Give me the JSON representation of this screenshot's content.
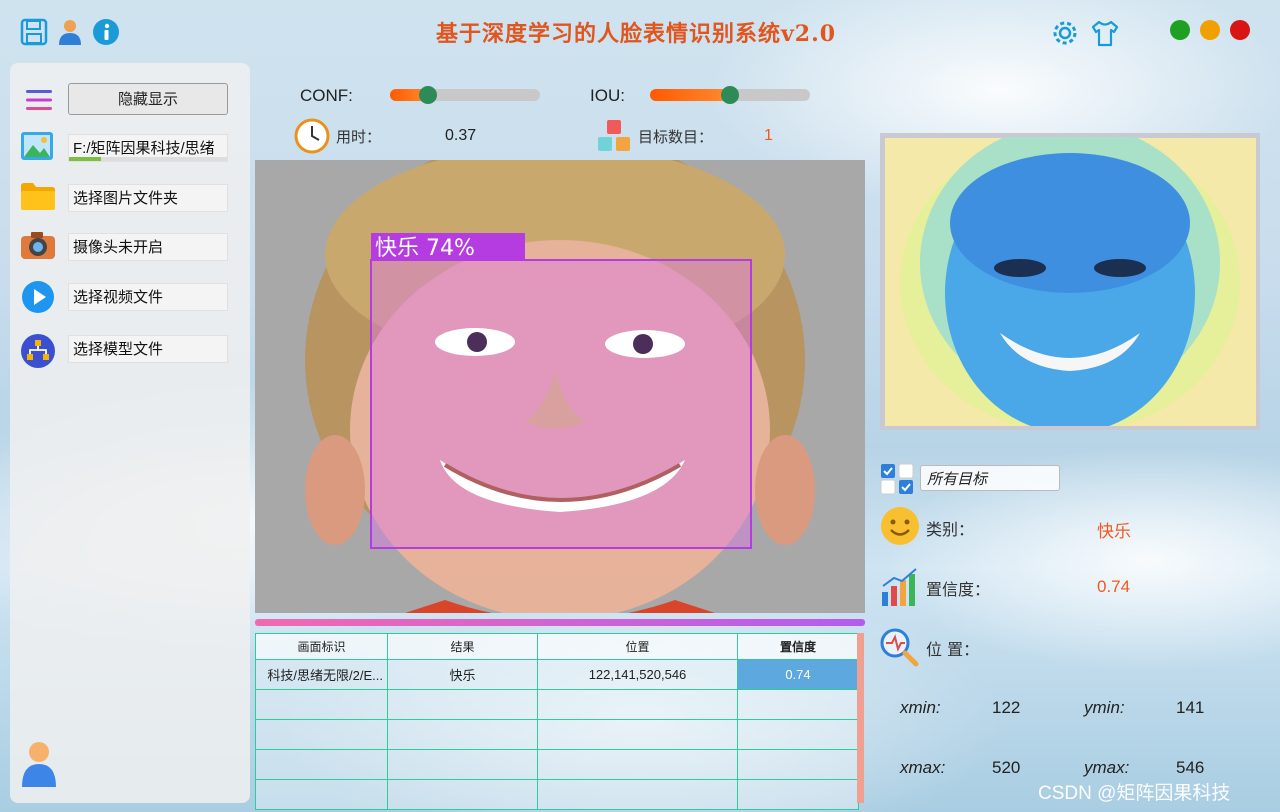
{
  "window": {
    "title": "基于深度学习的人脸表情识别系统v2.0",
    "controls": [
      "close",
      "minimize",
      "maximize"
    ]
  },
  "toolbar": {
    "left_icons": [
      "save-icon",
      "user-icon",
      "info-icon"
    ],
    "right_icons": [
      "gear-icon",
      "shirt-icon"
    ]
  },
  "sidebar": {
    "toggle_label": "隐藏显示",
    "items": [
      {
        "icon": "image-icon",
        "label": "F:/矩阵因果科技/思绪"
      },
      {
        "icon": "folder-icon",
        "label": "选择图片文件夹"
      },
      {
        "icon": "camera-icon",
        "label": "摄像头未开启"
      },
      {
        "icon": "play-icon",
        "label": "选择视频文件"
      },
      {
        "icon": "model-icon",
        "label": "选择模型文件"
      }
    ],
    "progress": 0.2
  },
  "params": {
    "conf_label": "CONF:",
    "conf_value": 0.25,
    "iou_label": "IOU:",
    "iou_value": 0.5
  },
  "stats": {
    "time_label": "用时：",
    "time_value": "0.37",
    "count_label": "目标数目：",
    "count_value": "1"
  },
  "detection": {
    "box_label": "快乐  74%",
    "color": "#b53ce0"
  },
  "table": {
    "headers": [
      "画面标识",
      "结果",
      "位置",
      "置信度"
    ],
    "rows": [
      [
        "科技/思绪无限/2/E...",
        "快乐",
        "122,141,520,546",
        "0.74"
      ],
      [
        "",
        "",
        "",
        ""
      ],
      [
        "",
        "",
        "",
        ""
      ],
      [
        "",
        "",
        "",
        ""
      ],
      [
        "",
        "",
        "",
        ""
      ]
    ]
  },
  "right_panel": {
    "target_select": "所有目标",
    "class_label": "类别：",
    "class_value": "快乐",
    "conf_label": "置信度：",
    "conf_value": "0.74",
    "pos_label": "位  置：",
    "xmin_label": "xmin:",
    "xmin_value": "122",
    "ymin_label": "ymin:",
    "ymin_value": "141",
    "xmax_label": "xmax:",
    "xmax_value": "520",
    "ymax_label": "ymax:",
    "ymax_value": "546"
  },
  "watermark": "CSDN @矩阵因果科技",
  "colors": {
    "accent": "#f05a1e",
    "slider_knob": "#2e8b57",
    "table_border": "#2ecc9a",
    "selection": "#5ea8e0"
  }
}
